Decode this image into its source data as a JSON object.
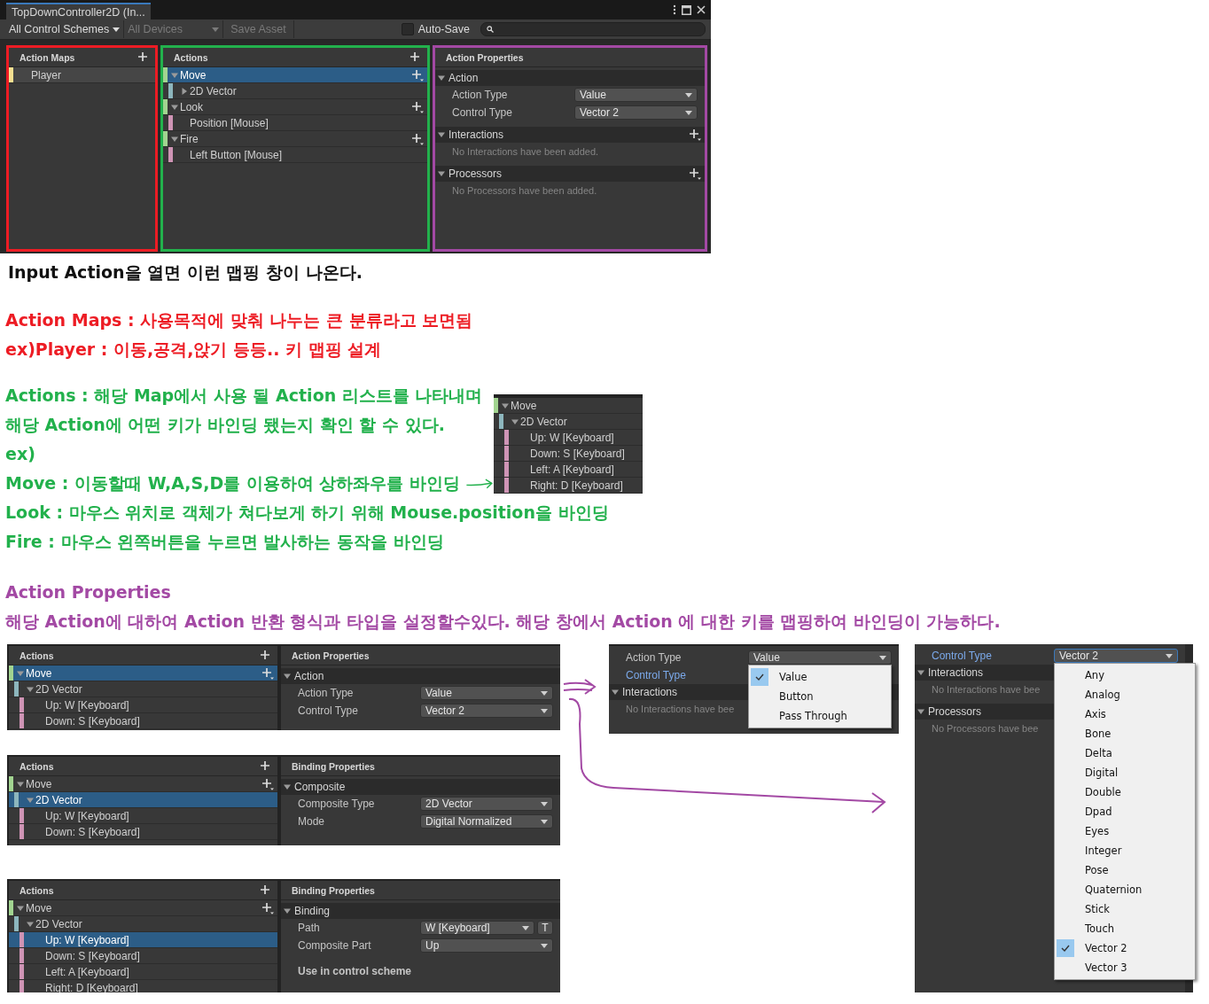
{
  "editor": {
    "tab_title": "TopDownController2D (In...",
    "toolbar": {
      "control_schemes": {
        "label": "All Control Schemes",
        "disabled": false
      },
      "devices": {
        "label": "All Devices",
        "disabled": true
      },
      "save_button": {
        "label": "Save Asset",
        "disabled": true
      },
      "auto_save": {
        "label": "Auto-Save",
        "checked": false
      }
    },
    "maps_panel": {
      "title": "Action Maps",
      "items": [
        {
          "label": "Player",
          "selected": true
        }
      ]
    },
    "actions_panel": {
      "title": "Actions",
      "tree": [
        {
          "label": "Move",
          "kind": "action",
          "expanded": true,
          "add_button": true,
          "selected": true,
          "children": [
            {
              "label": "2D Vector",
              "kind": "composite",
              "expanded": false,
              "selected": false
            }
          ]
        },
        {
          "label": "Look",
          "kind": "action",
          "expanded": true,
          "add_button": true,
          "selected": false,
          "children": [
            {
              "label": "Position [Mouse]",
              "kind": "binding",
              "selected": false
            }
          ]
        },
        {
          "label": "Fire",
          "kind": "action",
          "expanded": true,
          "add_button": true,
          "selected": false,
          "children": [
            {
              "label": "Left Button [Mouse]",
              "kind": "binding",
              "selected": false
            }
          ]
        }
      ]
    },
    "properties_panel": {
      "title": "Action Properties",
      "sections": [
        {
          "title": "Action",
          "expanded": true,
          "add_button": false,
          "fields": [
            {
              "kind": "dropdown",
              "label": "Action Type",
              "value": "Value",
              "highlighted": false,
              "focused": false
            },
            {
              "kind": "dropdown",
              "label": "Control Type",
              "value": "Vector 2",
              "highlighted": false,
              "focused": false
            }
          ]
        },
        {
          "title": "Interactions",
          "expanded": true,
          "add_button": true,
          "note": "No Interactions have been added."
        },
        {
          "title": "Processors",
          "expanded": true,
          "add_button": true,
          "note": "No Processors have been added."
        }
      ]
    }
  },
  "caption": "Input Action을 열면 이런 맵핑 창이 나온다.",
  "notes": [
    {
      "color": "#ed1c24",
      "lines": [
        "Action Maps : 사용목적에 맞춰 나누는 큰 분류라고 보면됨",
        "ex)Player : 이동,공격,앉기 등등.. 키 맵핑 설계"
      ]
    },
    {
      "color": "#22b14c",
      "lines": [
        {
          "text": "Actions : 해당 Map에서 사용 될 Action 리스트를 나타내며",
          "arrow": false
        },
        {
          "text": "해당 Action에 어떤 키가 바인딩 됐는지 확인 할 수 있다.",
          "arrow": false
        },
        {
          "text": "ex)",
          "arrow": false
        },
        {
          "text": "Move : 이동할때  W,A,S,D를 이용하여 상하좌우를 바인딩",
          "arrow": true
        },
        {
          "text": "Look : 마우스 위치로 객체가 쳐다보게 하기 위해 Mouse.position을 바인딩",
          "arrow": false
        },
        {
          "text": "Fire : 마우스 왼쪽버튼을 누르면 발사하는 동작을 바인딩",
          "arrow": false
        }
      ],
      "inset": {
        "tree": [
          {
            "label": "Move",
            "kind": "action",
            "expanded": true,
            "add_button": false,
            "selected": false,
            "children": [
              {
                "label": "2D Vector",
                "kind": "composite",
                "expanded": true,
                "selected": false,
                "children": [
                  {
                    "label": "Up: W [Keyboard]",
                    "kind": "binding",
                    "selected": false
                  },
                  {
                    "label": "Down: S [Keyboard]",
                    "kind": "binding",
                    "selected": false
                  },
                  {
                    "label": "Left: A [Keyboard]",
                    "kind": "binding",
                    "selected": false
                  },
                  {
                    "label": "Right: D [Keyboard]",
                    "kind": "binding",
                    "selected": false
                  }
                ]
              }
            ]
          }
        ]
      }
    },
    {
      "color": "#a349a4",
      "lines": [
        "Action Properties",
        "해당 Action에 대하여 Action 반환 형식과 타입을 설정할수있다.  해당 창에서 Action 에 대한 키를 맵핑하여 바인딩이 가능하다."
      ]
    }
  ],
  "examples": {
    "steps": [
      {
        "actions_panel": {
          "title": "Actions",
          "tree": [
            {
              "label": "Move",
              "kind": "action",
              "expanded": true,
              "add_button": true,
              "selected": true,
              "children": [
                {
                  "label": "2D Vector",
                  "kind": "composite",
                  "expanded": true,
                  "selected": false,
                  "children": [
                    {
                      "label": "Up: W [Keyboard]",
                      "kind": "binding",
                      "selected": false
                    },
                    {
                      "label": "Down: S [Keyboard]",
                      "kind": "binding",
                      "selected": false
                    }
                  ]
                }
              ]
            }
          ]
        },
        "properties_panel": {
          "title": "Action Properties",
          "sections": [
            {
              "title": "Action",
              "expanded": true,
              "add_button": false,
              "fields": [
                {
                  "kind": "dropdown",
                  "label": "Action Type",
                  "value": "Value",
                  "highlighted": false,
                  "focused": false
                },
                {
                  "kind": "dropdown",
                  "label": "Control Type",
                  "value": "Vector 2",
                  "highlighted": false,
                  "focused": false
                }
              ]
            }
          ]
        }
      },
      {
        "actions_panel": {
          "title": "Actions",
          "tree": [
            {
              "label": "Move",
              "kind": "action",
              "expanded": true,
              "add_button": true,
              "selected": false,
              "children": [
                {
                  "label": "2D Vector",
                  "kind": "composite",
                  "expanded": true,
                  "selected": true,
                  "children": [
                    {
                      "label": "Up: W [Keyboard]",
                      "kind": "binding",
                      "selected": false
                    },
                    {
                      "label": "Down: S [Keyboard]",
                      "kind": "binding",
                      "selected": false
                    }
                  ]
                }
              ]
            }
          ]
        },
        "properties_panel": {
          "title": "Binding Properties",
          "sections": [
            {
              "title": "Composite",
              "expanded": true,
              "add_button": false,
              "fields": [
                {
                  "kind": "dropdown",
                  "label": "Composite Type",
                  "value": "2D Vector",
                  "highlighted": false,
                  "focused": false
                },
                {
                  "kind": "dropdown",
                  "label": "Mode",
                  "value": "Digital Normalized",
                  "highlighted": false,
                  "focused": false
                }
              ]
            }
          ]
        }
      },
      {
        "actions_panel": {
          "title": "Actions",
          "tree": [
            {
              "label": "Move",
              "kind": "action",
              "expanded": true,
              "add_button": true,
              "selected": false,
              "children": [
                {
                  "label": "2D Vector",
                  "kind": "composite",
                  "expanded": true,
                  "selected": false,
                  "children": [
                    {
                      "label": "Up: W [Keyboard]",
                      "kind": "binding",
                      "selected": true
                    },
                    {
                      "label": "Down: S [Keyboard]",
                      "kind": "binding",
                      "selected": false
                    },
                    {
                      "label": "Left: A [Keyboard]",
                      "kind": "binding",
                      "selected": false
                    },
                    {
                      "label": "Right: D [Keyboard]",
                      "kind": "binding",
                      "selected": false
                    }
                  ]
                }
              ]
            }
          ]
        },
        "properties_panel": {
          "title": "Binding Properties",
          "sections": [
            {
              "title": "Binding",
              "expanded": true,
              "add_button": false,
              "fields": [
                {
                  "kind": "dropdown",
                  "label": "Path",
                  "value": "W [Keyboard]",
                  "button": "T",
                  "highlighted": false,
                  "focused": false
                },
                {
                  "kind": "dropdown",
                  "label": "Composite Part",
                  "value": "Up",
                  "highlighted": false,
                  "focused": false
                },
                {
                  "kind": "heading",
                  "label": "Use in control scheme"
                }
              ]
            }
          ]
        }
      }
    ],
    "action_type_popup": {
      "fields": [
        {
          "kind": "dropdown",
          "label": "Action Type",
          "value": "Value",
          "highlighted": false,
          "focused": false,
          "menu": [
            {
              "label": "Value",
              "checked": true
            },
            {
              "label": "Button",
              "checked": false
            },
            {
              "label": "Pass Through",
              "checked": false
            }
          ]
        },
        {
          "kind": "label",
          "label": "Control Type",
          "highlighted": true
        }
      ],
      "sections": [
        {
          "title": "Interactions",
          "expanded": true,
          "add_button": false,
          "note": "No Interactions have bee"
        }
      ]
    },
    "control_type_popup": {
      "fields": [
        {
          "kind": "dropdown",
          "label": "Control Type",
          "value": "Vector 2",
          "highlighted": true,
          "focused": true,
          "menu": [
            {
              "label": "Any",
              "checked": false
            },
            {
              "label": "Analog",
              "checked": false
            },
            {
              "label": "Axis",
              "checked": false
            },
            {
              "label": "Bone",
              "checked": false
            },
            {
              "label": "Delta",
              "checked": false
            },
            {
              "label": "Digital",
              "checked": false
            },
            {
              "label": "Double",
              "checked": false
            },
            {
              "label": "Dpad",
              "checked": false
            },
            {
              "label": "Eyes",
              "checked": false
            },
            {
              "label": "Integer",
              "checked": false
            },
            {
              "label": "Pose",
              "checked": false
            },
            {
              "label": "Quaternion",
              "checked": false
            },
            {
              "label": "Stick",
              "checked": false
            },
            {
              "label": "Touch",
              "checked": false
            },
            {
              "label": "Vector 2",
              "checked": true
            },
            {
              "label": "Vector 3",
              "checked": false
            }
          ]
        }
      ],
      "sections": [
        {
          "title": "Interactions",
          "expanded": true,
          "add_button": false,
          "note": "No Interactions have bee"
        },
        {
          "title": "Processors",
          "expanded": true,
          "add_button": false,
          "note": "No Processors have bee"
        }
      ]
    }
  }
}
